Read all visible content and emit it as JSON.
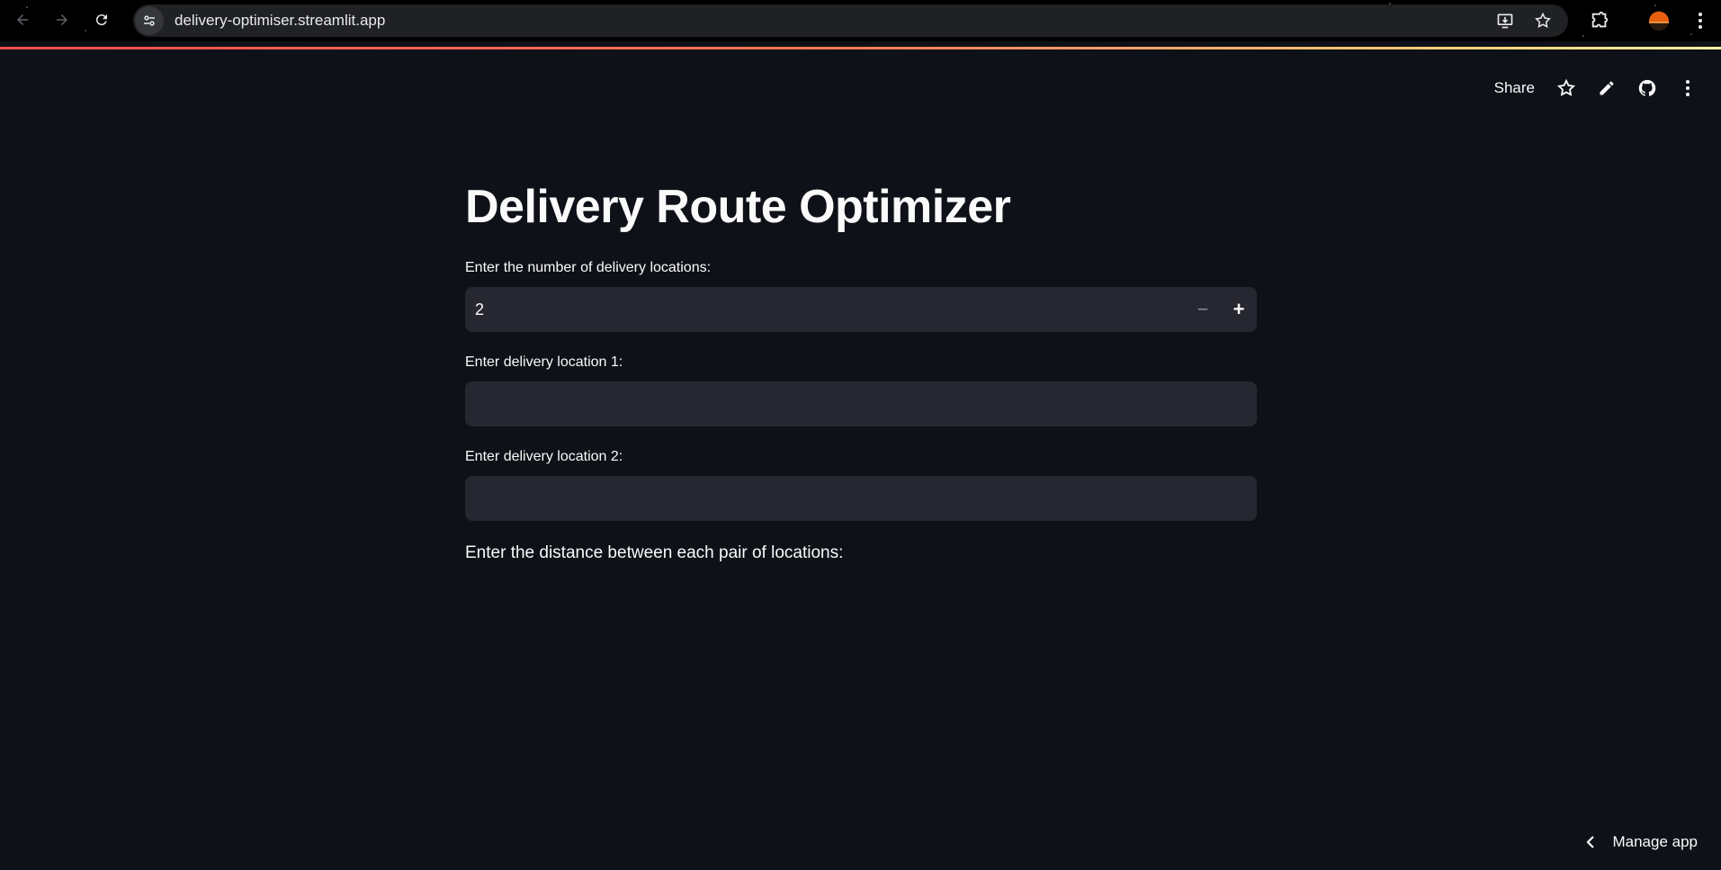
{
  "browser": {
    "url": "delivery-optimiser.streamlit.app"
  },
  "toolbar": {
    "share_label": "Share",
    "icons": [
      "star-icon",
      "pencil-icon",
      "github-icon",
      "kebab-menu-icon"
    ]
  },
  "main": {
    "title": "Delivery Route Optimizer",
    "num_locations": {
      "label": "Enter the number of delivery locations:",
      "value": "2",
      "minus": "−",
      "plus": "+"
    },
    "locations": [
      {
        "label": "Enter delivery location 1:",
        "value": ""
      },
      {
        "label": "Enter delivery location 2:",
        "value": ""
      }
    ],
    "distance_prompt": "Enter the distance between each pair of locations:"
  },
  "footer": {
    "manage_app_label": "Manage app"
  },
  "colors": {
    "background": "#0e1117",
    "input_background": "#262730",
    "accent": "#ff4b4b",
    "text": "#fafafa"
  }
}
